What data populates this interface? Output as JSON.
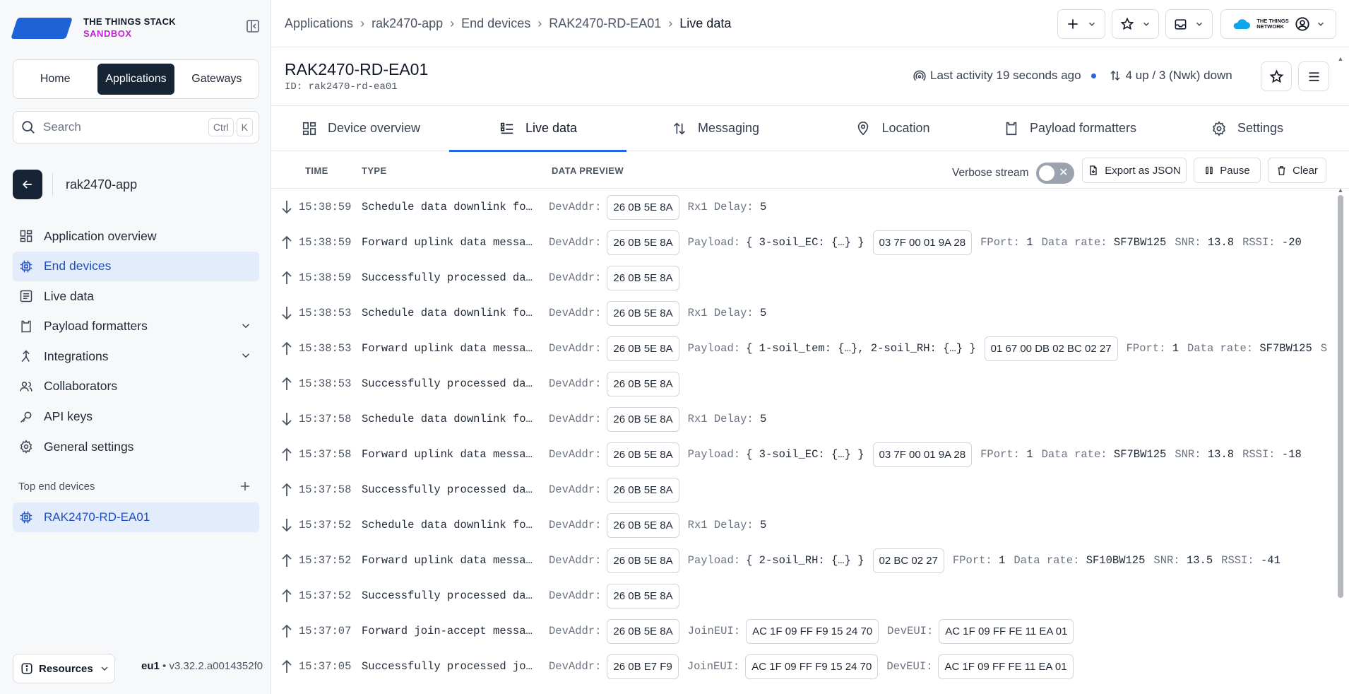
{
  "brand": {
    "line1": "THE THINGS STACK",
    "line2": "SANDBOX"
  },
  "seg": {
    "home": "Home",
    "applications": "Applications",
    "gateways": "Gateways"
  },
  "search": {
    "placeholder": "Search",
    "kbd1": "Ctrl",
    "kbd2": "K"
  },
  "app": {
    "name": "rak2470-app"
  },
  "nav": {
    "items": [
      {
        "label": "Application overview"
      },
      {
        "label": "End devices"
      },
      {
        "label": "Live data"
      },
      {
        "label": "Payload formatters"
      },
      {
        "label": "Integrations"
      },
      {
        "label": "Collaborators"
      },
      {
        "label": "API keys"
      },
      {
        "label": "General settings"
      }
    ]
  },
  "top_devices": {
    "heading": "Top end devices",
    "item": "RAK2470-RD-EA01"
  },
  "footer": {
    "resources": "Resources",
    "region": "eu1",
    "bullet": "•",
    "version": "v3.32.2.a0014352f0"
  },
  "breadcrumbs": [
    "Applications",
    "rak2470-app",
    "End devices",
    "RAK2470-RD-EA01",
    "Live data"
  ],
  "topbar": {
    "network_label_1": "THE THINGS",
    "network_label_2": "NETWORK"
  },
  "device": {
    "title": "RAK2470-RD-EA01",
    "id_label": "ID:",
    "id": "rak2470-rd-ea01",
    "last_activity": "Last activity 19 seconds ago",
    "traffic": "4 up / 3 (Nwk) down"
  },
  "tabs": [
    "Device overview",
    "Live data",
    "Messaging",
    "Location",
    "Payload formatters",
    "Settings"
  ],
  "table": {
    "col_time": "TIME",
    "col_type": "TYPE",
    "col_preview": "DATA PREVIEW",
    "verbose_label": "Verbose stream",
    "export": "Export as JSON",
    "pause": "Pause",
    "clear": "Clear"
  },
  "rows": [
    {
      "dir": "down",
      "time": "15:38:59",
      "type": "Schedule data downlink for…",
      "devaddr": "26 0B 5E 8A",
      "extra": [
        [
          "Rx1 Delay:",
          "5"
        ]
      ]
    },
    {
      "dir": "up",
      "time": "15:38:59",
      "type": "Forward uplink data message",
      "devaddr": "26 0B 5E 8A",
      "payload": "{ 3-soil_EC: {…} }",
      "bytes": "03 7F 00 01 9A 28",
      "extra": [
        [
          "FPort:",
          "1"
        ],
        [
          "Data rate:",
          "SF7BW125"
        ],
        [
          "SNR:",
          "13.8"
        ],
        [
          "RSSI:",
          "-20"
        ]
      ]
    },
    {
      "dir": "up",
      "time": "15:38:59",
      "type": "Successfully processed dat…",
      "devaddr": "26 0B 5E 8A"
    },
    {
      "dir": "down",
      "time": "15:38:53",
      "type": "Schedule data downlink for…",
      "devaddr": "26 0B 5E 8A",
      "extra": [
        [
          "Rx1 Delay:",
          "5"
        ]
      ]
    },
    {
      "dir": "up",
      "time": "15:38:53",
      "type": "Forward uplink data message",
      "devaddr": "26 0B 5E 8A",
      "payload": "{ 1-soil_tem: {…}, 2-soil_RH: {…} }",
      "bytes": "01 67 00 DB 02 BC 02 27",
      "extra": [
        [
          "FPort:",
          "1"
        ],
        [
          "Data rate:",
          "SF7BW125"
        ],
        [
          "S",
          ""
        ]
      ]
    },
    {
      "dir": "up",
      "time": "15:38:53",
      "type": "Successfully processed dat…",
      "devaddr": "26 0B 5E 8A"
    },
    {
      "dir": "down",
      "time": "15:37:58",
      "type": "Schedule data downlink for…",
      "devaddr": "26 0B 5E 8A",
      "extra": [
        [
          "Rx1 Delay:",
          "5"
        ]
      ]
    },
    {
      "dir": "up",
      "time": "15:37:58",
      "type": "Forward uplink data message",
      "devaddr": "26 0B 5E 8A",
      "payload": "{ 3-soil_EC: {…} }",
      "bytes": "03 7F 00 01 9A 28",
      "extra": [
        [
          "FPort:",
          "1"
        ],
        [
          "Data rate:",
          "SF7BW125"
        ],
        [
          "SNR:",
          "13.8"
        ],
        [
          "RSSI:",
          "-18"
        ]
      ]
    },
    {
      "dir": "up",
      "time": "15:37:58",
      "type": "Successfully processed dat…",
      "devaddr": "26 0B 5E 8A"
    },
    {
      "dir": "down",
      "time": "15:37:52",
      "type": "Schedule data downlink for…",
      "devaddr": "26 0B 5E 8A",
      "extra": [
        [
          "Rx1 Delay:",
          "5"
        ]
      ]
    },
    {
      "dir": "up",
      "time": "15:37:52",
      "type": "Forward uplink data message",
      "devaddr": "26 0B 5E 8A",
      "payload": "{ 2-soil_RH: {…} }",
      "bytes": "02 BC 02 27",
      "extra": [
        [
          "FPort:",
          "1"
        ],
        [
          "Data rate:",
          "SF10BW125"
        ],
        [
          "SNR:",
          "13.5"
        ],
        [
          "RSSI:",
          "-41"
        ]
      ]
    },
    {
      "dir": "up",
      "time": "15:37:52",
      "type": "Successfully processed dat…",
      "devaddr": "26 0B 5E 8A"
    },
    {
      "dir": "up",
      "time": "15:37:07",
      "type": "Forward join-accept message",
      "devaddr": "26 0B 5E 8A",
      "joineui": "AC 1F 09 FF F9 15 24 70",
      "deveui": "AC 1F 09 FF FE 11 EA 01"
    },
    {
      "dir": "up",
      "time": "15:37:05",
      "type": "Successfully processed joi…",
      "devaddr": "26 0B E7 F9",
      "joineui": "AC 1F 09 FF F9 15 24 70",
      "deveui": "AC 1F 09 FF FE 11 EA 01"
    }
  ],
  "labels": {
    "devaddr": "DevAddr:",
    "payload": "Payload:",
    "joineui": "JoinEUI:",
    "deveui": "DevEUI:"
  },
  "colors": {
    "navy": "#162436",
    "accent": "#2563eb",
    "active_bg": "#e3ecfb",
    "brand_pink": "#c026d3"
  }
}
